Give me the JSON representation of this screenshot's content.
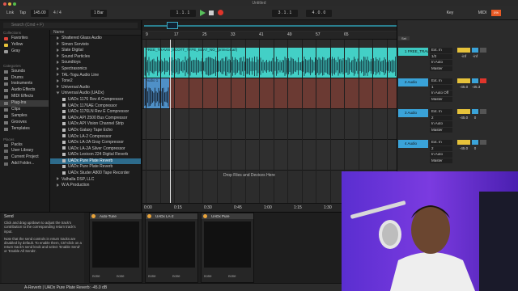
{
  "window": {
    "title": "Untitled"
  },
  "transport": {
    "link": "Link",
    "tap": "Tap",
    "tempo": "145.00",
    "time_sig": "4 / 4",
    "quant": "1 Bar",
    "position": "1 . 1 . 1",
    "loop_start": "3 . 1 . 1",
    "loop_len": "4 . 0 . 0",
    "key": "Key",
    "midi": "MIDI",
    "cpu": "0%"
  },
  "browser": {
    "search_placeholder": "Search (Cmd + F)",
    "collections_header": "Collections",
    "collections": [
      {
        "label": "Favorites",
        "color": "#e0433a"
      },
      {
        "label": "Yellow",
        "color": "#e6c23a"
      },
      {
        "label": "Gray",
        "color": "#9a9a9a"
      }
    ],
    "categories_header": "Categories",
    "categories": [
      "Sounds",
      "Drums",
      "Instruments",
      "Audio Effects",
      "MIDI Effects",
      "Plug-Ins",
      "Clips",
      "Samples",
      "Grooves",
      "Templates"
    ],
    "selected_category": "Plug-Ins",
    "places_header": "Places",
    "places": [
      "Packs",
      "User Library",
      "Current Project",
      "Add Folder..."
    ],
    "list_header": "Name",
    "items": [
      {
        "label": "Shattered Glass Audio",
        "type": "folder"
      },
      {
        "label": "Simon Sorvisto",
        "type": "folder"
      },
      {
        "label": "Slate Digital",
        "type": "folder"
      },
      {
        "label": "Sound Particles",
        "type": "folder"
      },
      {
        "label": "Soundtoys",
        "type": "folder"
      },
      {
        "label": "Spectrasonics",
        "type": "folder"
      },
      {
        "label": "TAL-Togu Audio Line",
        "type": "folder"
      },
      {
        "label": "Tone2",
        "type": "folder"
      },
      {
        "label": "Universal Audio",
        "type": "folder"
      },
      {
        "label": "Universal Audio (UADx)",
        "type": "open"
      },
      {
        "label": "UADx 1176 Rev A Compressor",
        "type": "plugin"
      },
      {
        "label": "UADx 1176AE Compressor",
        "type": "plugin"
      },
      {
        "label": "UADx 1176LN Rev E Compressor",
        "type": "plugin"
      },
      {
        "label": "UADx API 2500 Bus Compressor",
        "type": "plugin"
      },
      {
        "label": "UADx API Vision Channel Strip",
        "type": "plugin"
      },
      {
        "label": "UADx Galaxy Tape Echo",
        "type": "plugin"
      },
      {
        "label": "UADx LA-2 Compressor",
        "type": "plugin"
      },
      {
        "label": "UADx LA-2A Gray Compressor",
        "type": "plugin"
      },
      {
        "label": "UADx LA-2A Silver Compressor",
        "type": "plugin"
      },
      {
        "label": "UADx Lexicon 224 Digital Reverb",
        "type": "plugin"
      },
      {
        "label": "UADx Pure Plate Reverb",
        "type": "selected"
      },
      {
        "label": "UADx Pure Plate Reverb",
        "type": "plugin"
      },
      {
        "label": "UADx Studer A800 Tape Recorder",
        "type": "plugin"
      },
      {
        "label": "Valhalla DSP, LLC",
        "type": "folder"
      },
      {
        "label": "W.A.Production",
        "type": "folder"
      }
    ]
  },
  "arrangement": {
    "ruler": [
      "9",
      "17",
      "25",
      "33",
      "41",
      "49",
      "57",
      "65"
    ],
    "time_ruler": [
      "0:00",
      "0:15",
      "0:30",
      "0:45",
      "1:00",
      "1:15",
      "1:30"
    ],
    "clip1_name": "FREE_TRAVIS_SCOTT_TYPE_BEAT_NO_(prims14.aif)",
    "clip2_name": "Audio 1",
    "drop_message": "Drop Files and Devices Here"
  },
  "tracks": [
    {
      "name": "1 FREE_TRAV",
      "color": "#3ec9c1",
      "input": "Ext. In",
      "channel": "1/2",
      "monitor": "In  Auto",
      "output": "Master",
      "vol": "-inf",
      "pan": "-inf"
    },
    {
      "name": "2 Audio",
      "color": "#3aa3d9",
      "input": "Ext. In",
      "channel": "1",
      "monitor": "In  Auto  Off",
      "output": "Master",
      "vol": "-45.0",
      "pan": "-45.3"
    },
    {
      "name": "3 Audio",
      "color": "#3aa3d9",
      "input": "Ext. In",
      "channel": "2",
      "monitor": "In  Auto",
      "output": "Master",
      "vol": "-45.0",
      "pan": "0"
    },
    {
      "name": "4 Audio",
      "color": "#3aa3d9",
      "input": "Ext. In",
      "channel": "2",
      "monitor": "In  Auto",
      "output": "Master",
      "vol": "-45.0",
      "pan": "0"
    }
  ],
  "mixer": {
    "set_label": "Set"
  },
  "info": {
    "title": "Send",
    "body": "Click and drag up/down to adjust the track's contribution to the corresponding return track's input.",
    "note": "Note that the send controls in return tracks are disabled by default. To enable them, Ctrl-click on a return track's send knob and select 'Enable Send' or 'Enable All Sends'."
  },
  "devices": [
    {
      "name": "Auto-Tune",
      "sel1": "none",
      "sel2": "none"
    },
    {
      "name": "UADx LA-2",
      "sel1": "none",
      "sel2": "none"
    },
    {
      "name": "UADx Pure",
      "sel1": "none",
      "sel2": "none"
    }
  ],
  "status": {
    "text": "A-Reverb | UADx Pure Plate Reverb: -45.0 dB"
  }
}
